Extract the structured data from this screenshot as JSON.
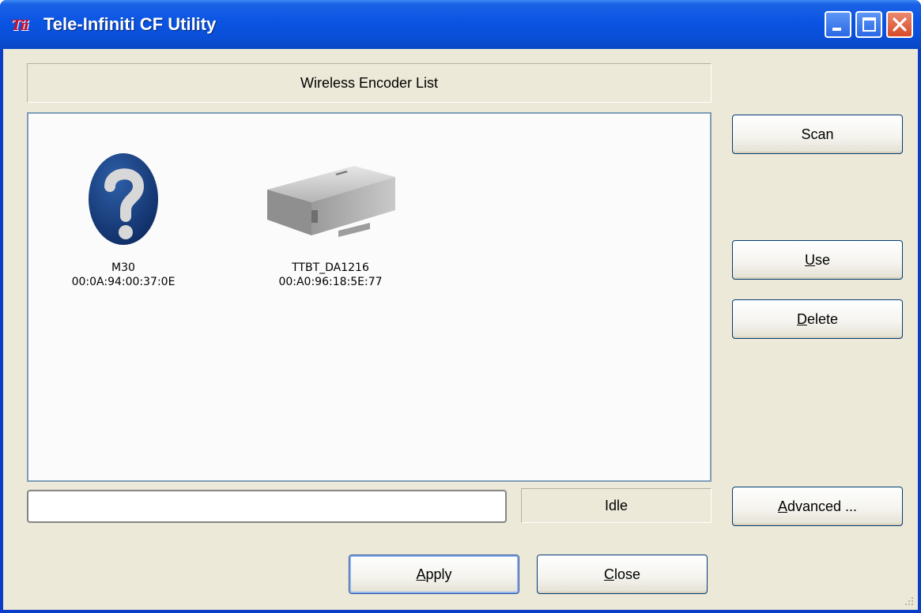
{
  "window": {
    "title": "Tele-Infiniti CF Utility",
    "icon_text": "Tii"
  },
  "header": {
    "label": "Wireless Encoder List"
  },
  "encoders": [
    {
      "name": "M30",
      "mac": "00:0A:94:00:37:0E",
      "icon": "question-mark-icon"
    },
    {
      "name": "TTBT_DA1216",
      "mac": "00:A0:96:18:5E:77",
      "icon": "encoder-device-icon"
    }
  ],
  "buttons": {
    "scan": "Scan",
    "use_first": "U",
    "use_rest": "se",
    "delete_first": "D",
    "delete_rest": "elete",
    "advanced_first": "A",
    "advanced_rest": "dvanced ...",
    "apply_first": "A",
    "apply_rest": "pply",
    "close_first": "C",
    "close_rest": "lose"
  },
  "status": {
    "text": "Idle"
  },
  "progress": {
    "value": 0
  },
  "colors": {
    "titlebar": "#0a54e3",
    "face": "#ece9d8",
    "list_border": "#7f9db9",
    "close": "#d84a28"
  }
}
